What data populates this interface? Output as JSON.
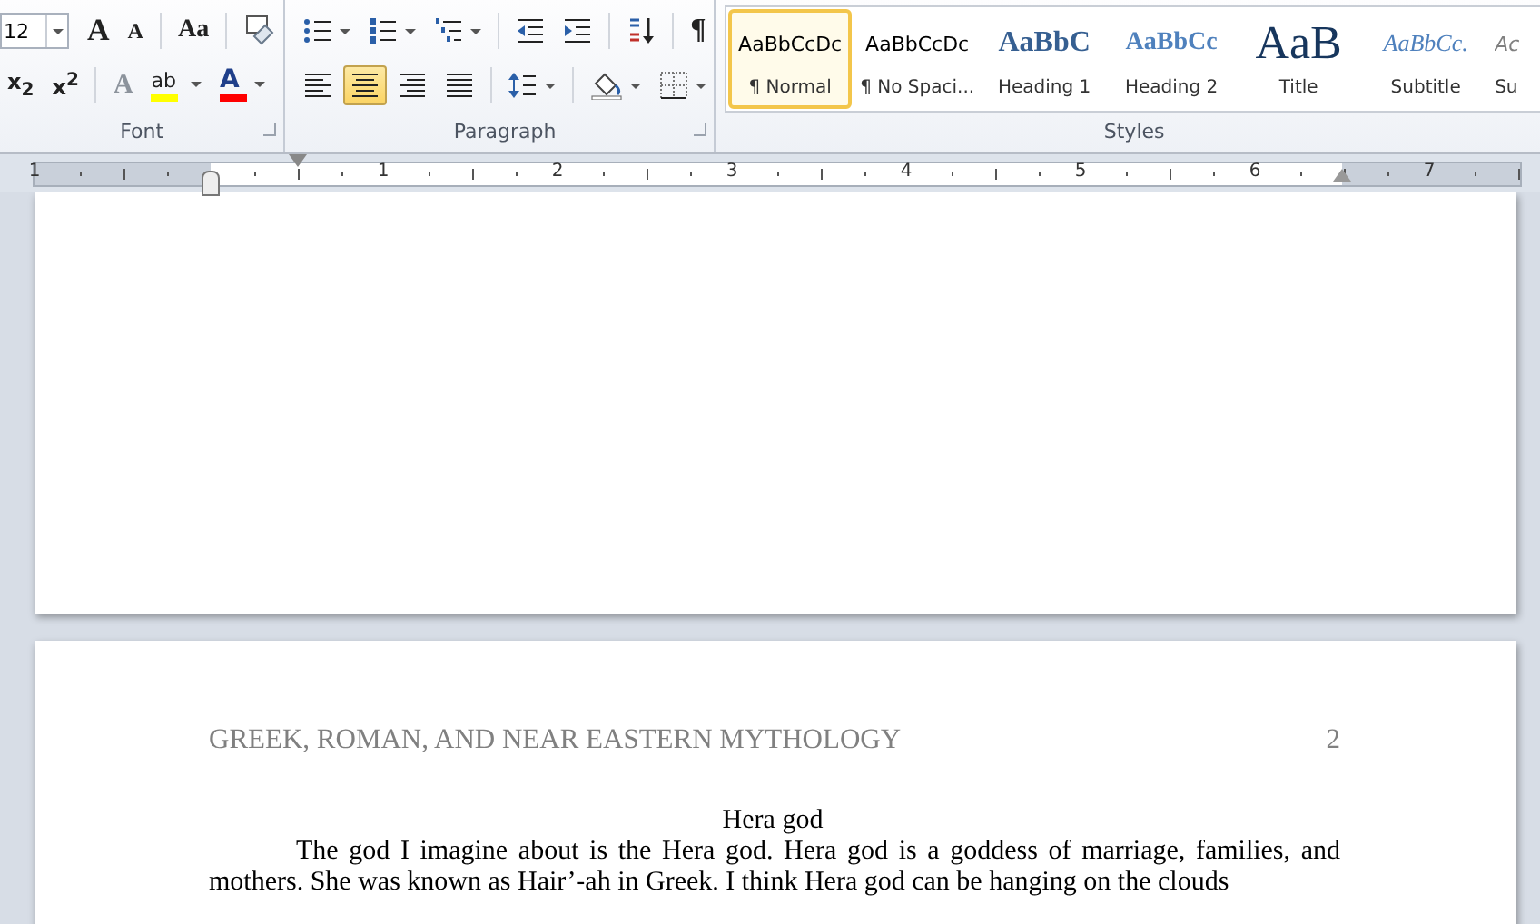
{
  "ribbon": {
    "font_group": {
      "label": "Font",
      "font_size": "12",
      "row1": [
        {
          "kind": "grow",
          "glyph": "A"
        },
        {
          "kind": "shrink",
          "glyph": "A"
        },
        {
          "kind": "separator"
        },
        {
          "kind": "case",
          "glyph": "Aa"
        },
        {
          "kind": "separator"
        },
        {
          "kind": "clear"
        }
      ],
      "row2": [
        {
          "kind": "subscript",
          "glyph": "x$_{2}$"
        },
        {
          "kind": "superscript",
          "glyph": "x$^{2}$"
        },
        {
          "kind": "separator"
        },
        {
          "kind": "effects",
          "glyph": "A",
          "disabled": true
        },
        {
          "kind": "highlight",
          "glyph": "ab",
          "color": "#ffff00"
        },
        {
          "kind": "fontcolor",
          "glyph": "A",
          "color": "#ff0000"
        }
      ]
    },
    "paragraph_group": {
      "label": "Paragraph",
      "row1": [
        {
          "kind": "bullets",
          "dropdown": true
        },
        {
          "kind": "numbering",
          "dropdown": true
        },
        {
          "kind": "multilevel",
          "dropdown": true
        },
        {
          "kind": "separator"
        },
        {
          "kind": "outdent",
          "dropdown": false
        },
        {
          "kind": "indent",
          "dropdown": false
        },
        {
          "kind": "separator"
        },
        {
          "kind": "sort",
          "dropdown": false
        },
        {
          "kind": "separator"
        },
        {
          "kind": "marks",
          "glyph": "¶"
        }
      ],
      "row2": [
        {
          "kind": "align-left",
          "selected": false
        },
        {
          "kind": "align-center",
          "selected": true
        },
        {
          "kind": "align-right",
          "selected": false
        },
        {
          "kind": "justify",
          "selected": false
        },
        {
          "kind": "separator"
        },
        {
          "kind": "spacing",
          "dropdown": true
        },
        {
          "kind": "separator"
        },
        {
          "kind": "shading",
          "dropdown": true
        },
        {
          "kind": "borders",
          "dropdown": true
        }
      ]
    },
    "styles_group": {
      "label": "Styles",
      "styles": [
        {
          "kind": "normal",
          "preview": "AaBbCcDc",
          "label": "¶ Normal",
          "selected": true
        },
        {
          "kind": "normal",
          "preview": "AaBbCcDc",
          "label": "¶ No Spaci...",
          "selected": false
        },
        {
          "kind": "heading1",
          "preview": "AaBbC",
          "label": "Heading 1",
          "selected": false
        },
        {
          "kind": "heading2",
          "preview": "AaBbCc",
          "label": "Heading 2",
          "selected": false
        },
        {
          "kind": "title",
          "preview": "AaB",
          "label": "Title",
          "selected": false
        },
        {
          "kind": "subtitle",
          "preview": "AaBbCc.",
          "label": "Subtitle",
          "selected": false
        },
        {
          "kind": "subtle",
          "preview": "Ac",
          "label": "Su",
          "selected": false
        }
      ]
    }
  },
  "ruler": {
    "left_numbers": [
      "1"
    ],
    "numbers": [
      "1",
      "2",
      "3",
      "4",
      "5",
      "6",
      "7"
    ]
  },
  "document": {
    "page_2": {
      "header": "GREEK, ROMAN, AND NEAR EASTERN MYTHOLOGY",
      "page_number": "2",
      "title": "Hera god",
      "paragraph": "The god I imagine about is the Hera god. Hera god is a goddess of marriage, families, and mothers. She was known as Hair’-ah in Greek. I think Hera god can be hanging on the clouds"
    }
  }
}
